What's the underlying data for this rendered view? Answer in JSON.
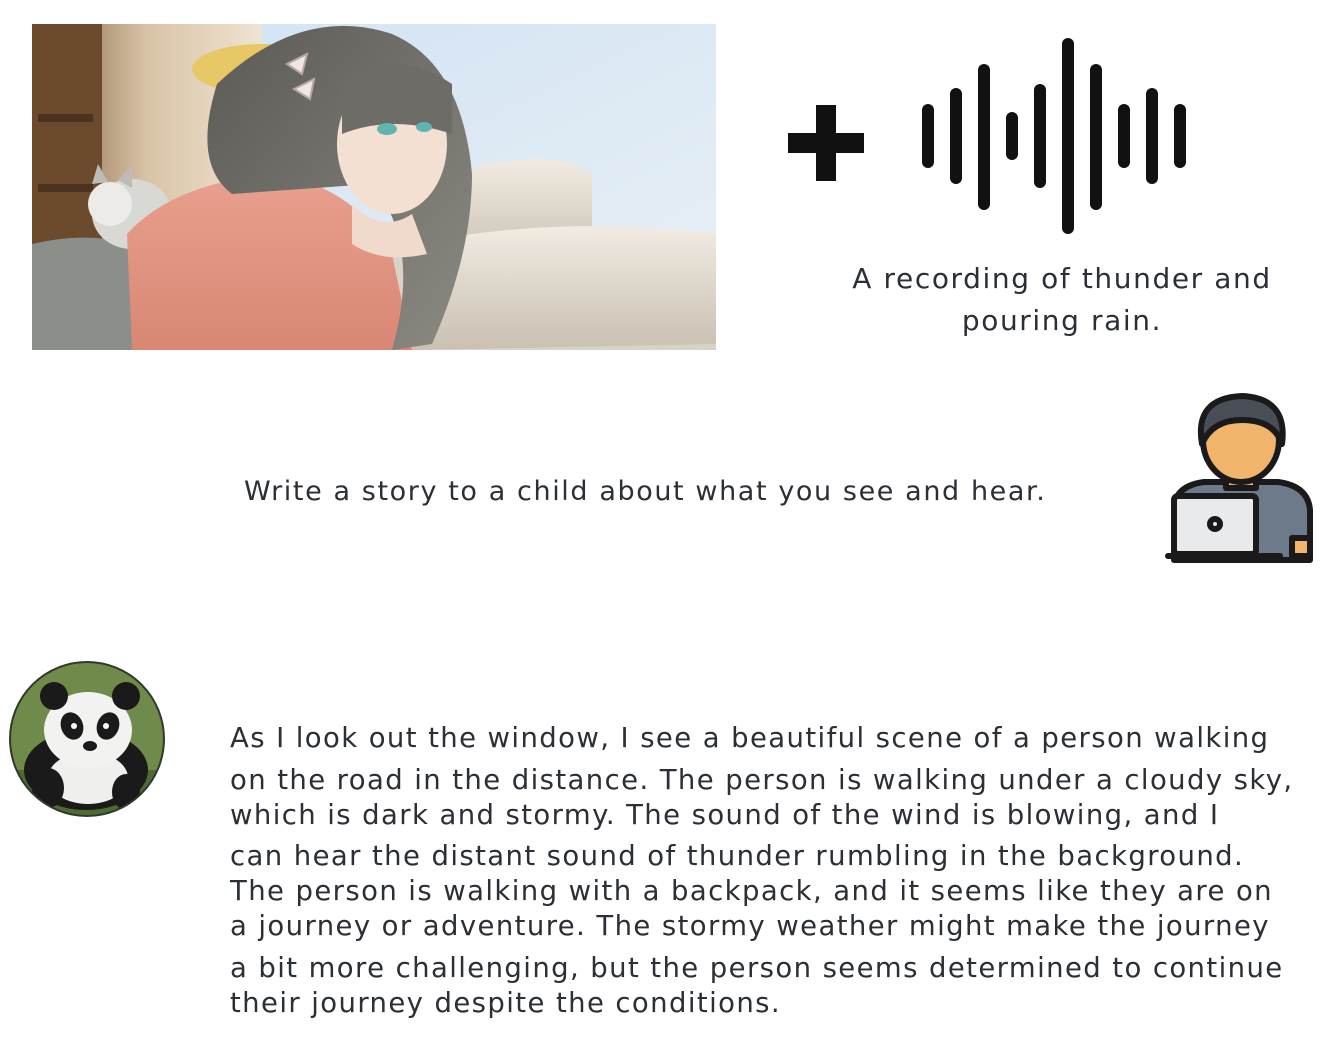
{
  "audio_input": {
    "caption": "A recording of thunder and pouring rain.",
    "icon": "sound-waveform-icon"
  },
  "operator_icon": "plus-icon",
  "image_input": {
    "icon": "illustration-girl-with-cat-by-window"
  },
  "prompt": {
    "text": "Write a story to a child about what you see and hear.",
    "user_icon": "user-at-laptop-icon"
  },
  "response": {
    "avatar_icon": "panda-avatar-icon",
    "lines": [
      "As I look out the window, I see a beautiful scene of a person walking",
      "on the road in the distance. The person is walking under a cloudy sky,",
      "which is dark and stormy. The sound of the wind is blowing, and I",
      "can hear the distant sound of thunder rumbling in the background.",
      "The person is walking with a backpack, and it seems like they are on",
      "a journey or adventure. The stormy weather might make the journey",
      "a bit more challenging, but the person seems determined to continue",
      "their journey despite the conditions."
    ]
  },
  "colors": {
    "text": "#2b2f36",
    "icon_black": "#111111",
    "avatar_skin": "#f0b46a",
    "avatar_hair": "#4a4f57",
    "avatar_shirt": "#6c7a89"
  }
}
